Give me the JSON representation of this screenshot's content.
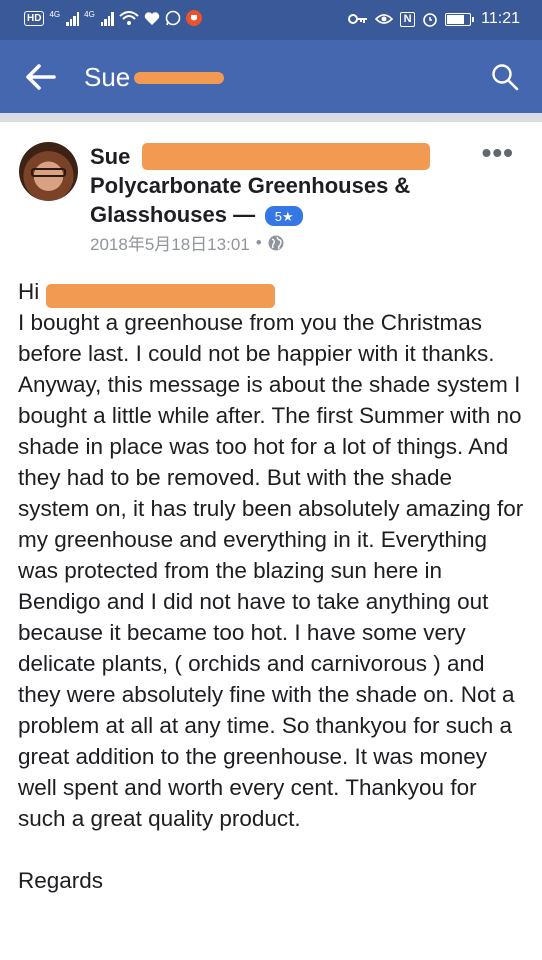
{
  "status_bar": {
    "hd_label": "HD",
    "signal_label": "4G",
    "nfc_label": "N",
    "time": "11:21"
  },
  "app_bar": {
    "title": "Sue",
    "back_icon": "back-arrow-icon",
    "search_icon": "search-icon"
  },
  "post": {
    "author_first": "Sue",
    "group_name_line1": "Polycarbonate Greenhouses &",
    "group_name_line2": "Glasshouses —",
    "level_badge": "5★",
    "timestamp": "2018年5月18日13:01",
    "separator": "•",
    "more_label": "•••",
    "greeting": "Hi",
    "paragraphs": [
      "I bought a greenhouse from you the Christmas before last. I could not be happier with it thanks.",
      "Anyway, this message is about the shade system I bought a little while after. The first Summer with no shade in place was too hot for a lot of things. And they had to be removed. But with the shade system on, it has truly been absolutely amazing for my greenhouse and everything in it. Everything was protected from the blazing sun here in Bendigo and I did not have to take anything out because it became too hot. I have some very delicate plants, ( orchids and carnivorous ) and they were absolutely fine with the shade on. Not a problem at all at any time. So thankyou for such a great addition to the greenhouse. It was money well spent and worth every cent. Thankyou for such a great quality product."
    ],
    "closing": "Regards"
  },
  "colors": {
    "status_bar": "#3a5998",
    "app_bar": "#4467b0",
    "redaction": "#f39a52",
    "badge": "#3578e5",
    "meta_text": "#90949c"
  }
}
